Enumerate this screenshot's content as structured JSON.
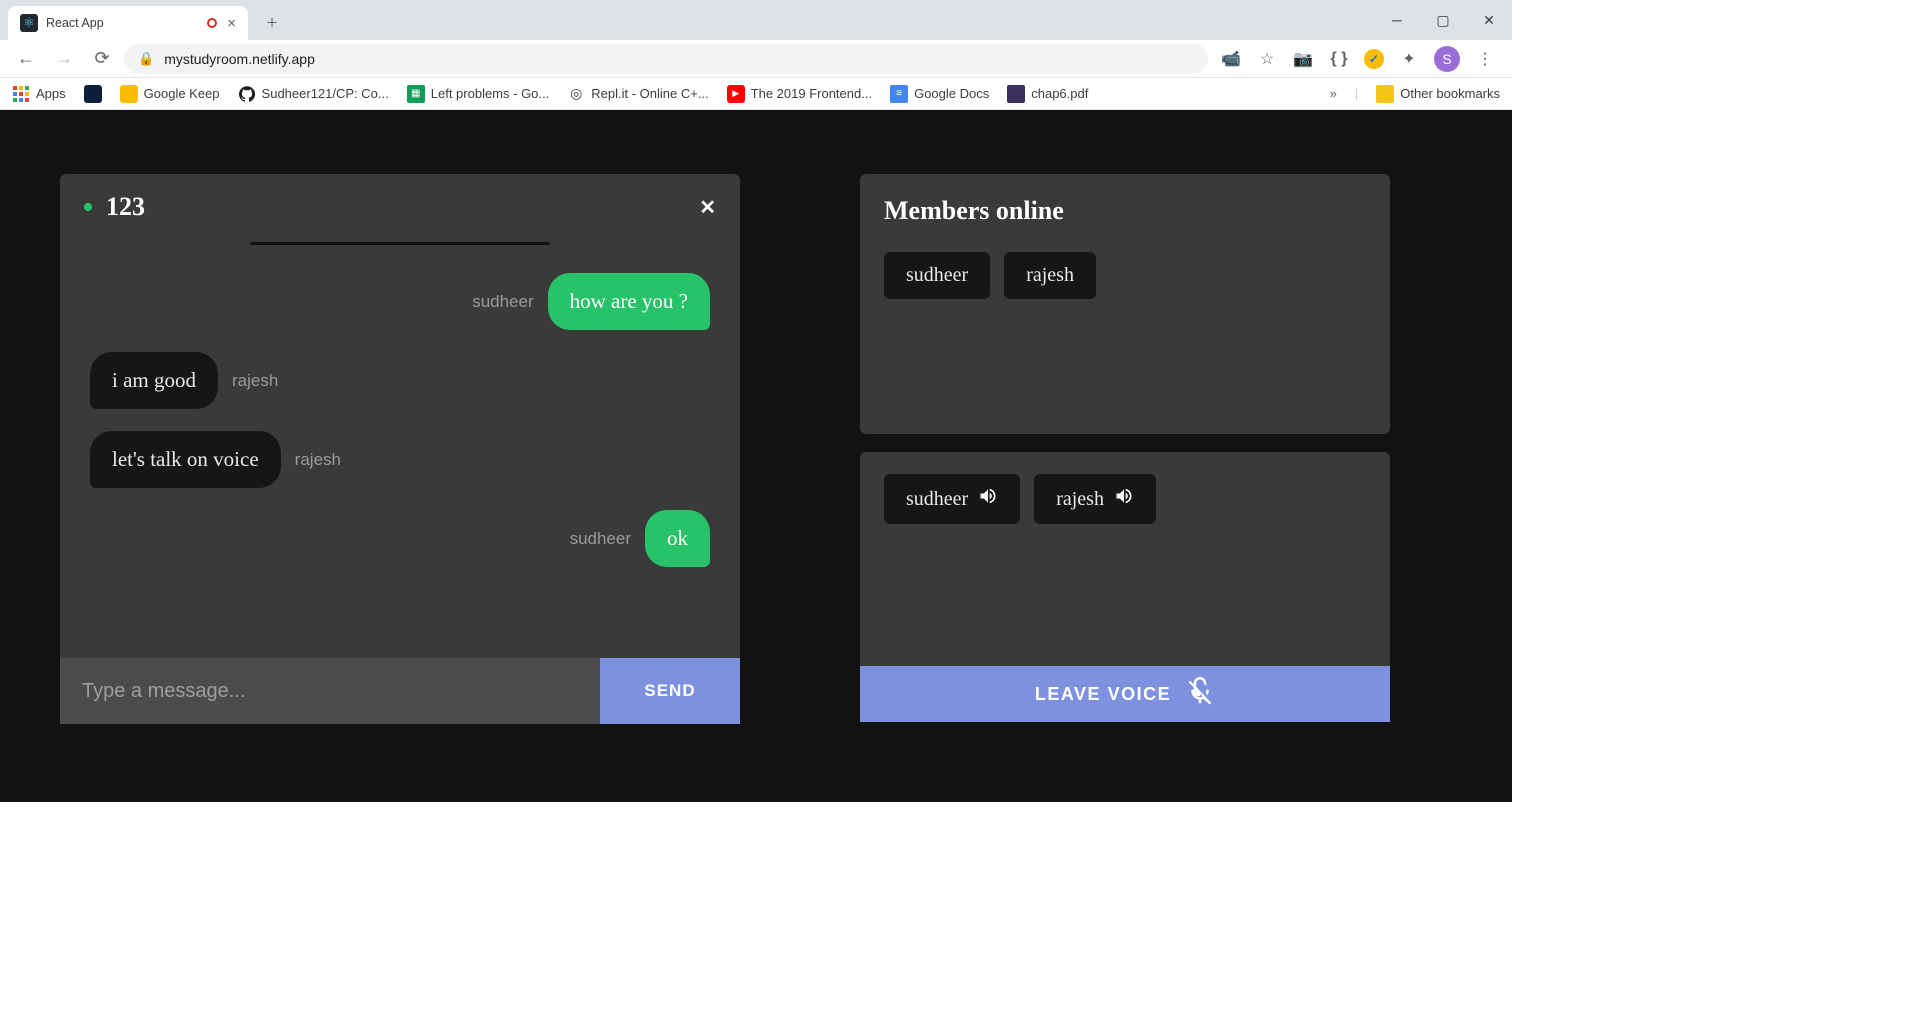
{
  "browser": {
    "tab_title": "React App",
    "url": "mystudyroom.netlify.app",
    "avatar_letter": "S",
    "bookmarks": [
      {
        "label": "Apps"
      },
      {
        "label": ""
      },
      {
        "label": "Google Keep"
      },
      {
        "label": "Sudheer121/CP: Co..."
      },
      {
        "label": "Left problems - Go..."
      },
      {
        "label": "Repl.it - Online C+..."
      },
      {
        "label": "The 2019 Frontend..."
      },
      {
        "label": "Google Docs"
      },
      {
        "label": "chap6.pdf"
      }
    ],
    "other_bookmarks": "Other bookmarks"
  },
  "chat": {
    "room_name": "123",
    "messages": [
      {
        "author": "sudheer",
        "text": "how are you ?",
        "side": "right"
      },
      {
        "author": "rajesh",
        "text": "i am good",
        "side": "left"
      },
      {
        "author": "rajesh",
        "text": "let's talk on voice",
        "side": "left"
      },
      {
        "author": "sudheer",
        "text": "ok",
        "side": "right"
      }
    ],
    "input_placeholder": "Type a message...",
    "send_label": "SEND"
  },
  "members": {
    "title": "Members online",
    "list": [
      "sudheer",
      "rajesh"
    ]
  },
  "voice": {
    "participants": [
      "sudheer",
      "rajesh"
    ],
    "leave_label": "LEAVE VOICE"
  }
}
